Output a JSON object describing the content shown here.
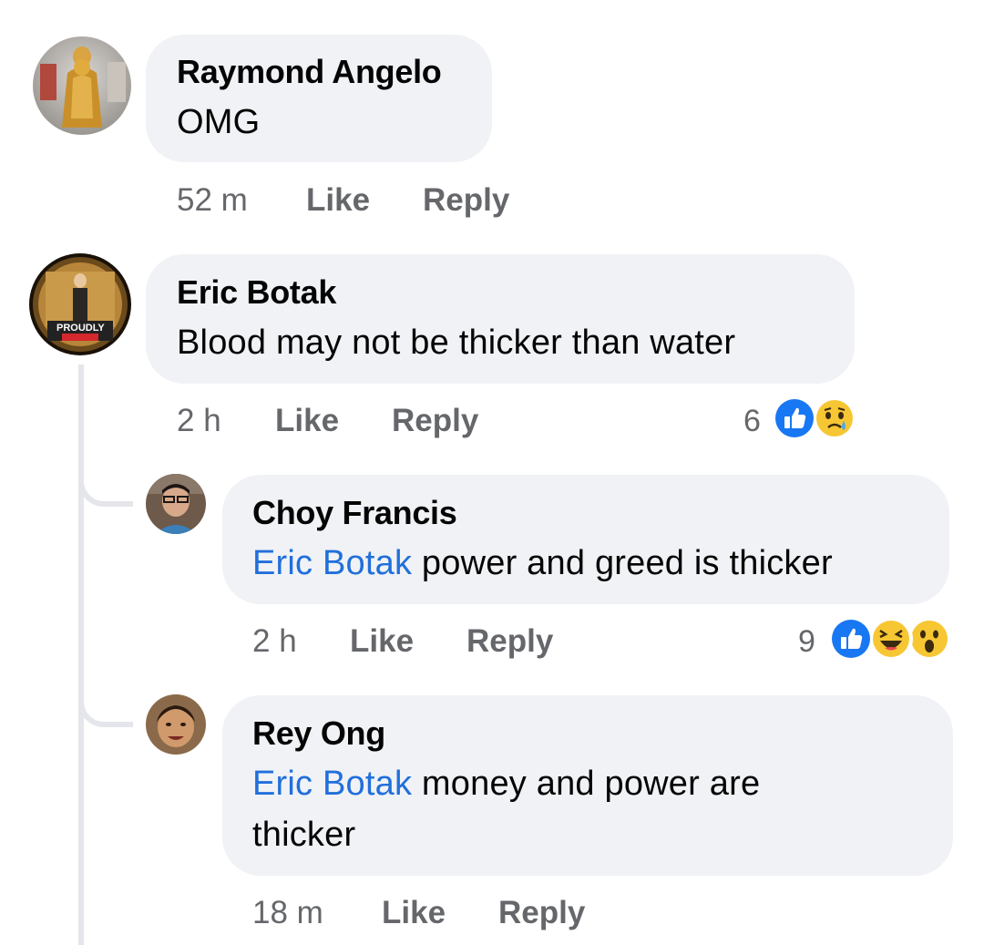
{
  "comments": [
    {
      "author": "Raymond Angelo",
      "text": "OMG",
      "time": "52 m",
      "like_label": "Like",
      "reply_label": "Reply"
    },
    {
      "author": "Eric Botak",
      "text": "Blood may not be thicker than water",
      "time": "2 h",
      "like_label": "Like",
      "reply_label": "Reply",
      "reaction_count": "6",
      "reactions": [
        "like-icon",
        "sad-icon"
      ],
      "avatar_badge": "PROUDLY"
    }
  ],
  "replies": [
    {
      "author": "Choy Francis",
      "mention": "Eric Botak",
      "text": " power and greed is thicker",
      "time": "2 h",
      "like_label": "Like",
      "reply_label": "Reply",
      "reaction_count": "9",
      "reactions": [
        "like-icon",
        "haha-icon",
        "wow-icon"
      ]
    },
    {
      "author": "Rey Ong",
      "mention": "Eric Botak",
      "text": " money and power are thicker",
      "time": "18 m",
      "like_label": "Like",
      "reply_label": "Reply"
    }
  ],
  "colors": {
    "bubble": "#f0f2f5",
    "meta": "#65676b",
    "mention": "#216fdb",
    "like_blue": "#1877f2",
    "emoji_yellow": "#f7c633"
  }
}
